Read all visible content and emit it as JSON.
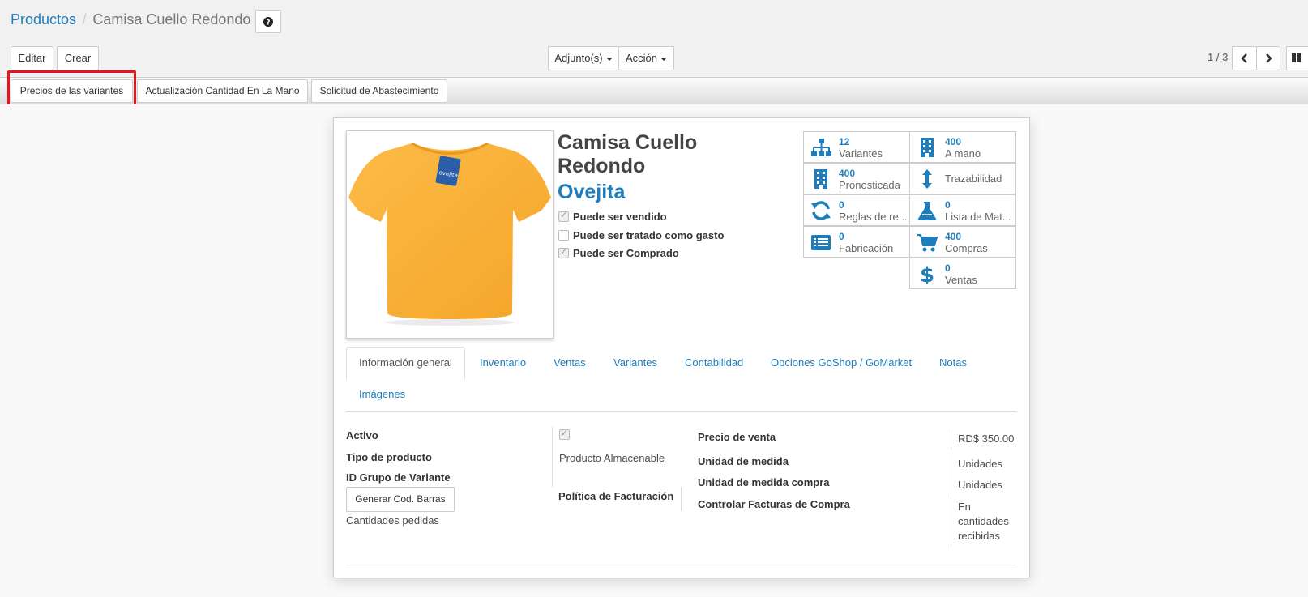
{
  "breadcrumb": {
    "parent": "Productos",
    "separator": "/",
    "current": "Camisa Cuello Redondo",
    "help_icon": "question-circle-icon"
  },
  "toolbar": {
    "edit_label": "Editar",
    "create_label": "Crear",
    "attachments_label": "Adjunto(s)",
    "action_label": "Acción",
    "pager": "1 / 3"
  },
  "statusbar": {
    "buttons": [
      "Precios de las variantes",
      "Actualización Cantidad En La Mano",
      "Solicitud de Abastecimiento"
    ]
  },
  "product": {
    "name_line1": "Camisa Cuello",
    "name_line2": "Redondo",
    "brand": "Ovejita",
    "image_icon": "orange-tshirt-image",
    "checkboxes": [
      {
        "label": "Puede ser vendido",
        "checked": true
      },
      {
        "label": "Puede ser tratado como gasto",
        "checked": false
      },
      {
        "label": "Puede ser Comprado",
        "checked": true
      }
    ]
  },
  "smart_buttons": [
    {
      "value": "12",
      "label": "Variantes",
      "icon": "sitemap-icon"
    },
    {
      "value": "400",
      "label": "A mano",
      "icon": "building-icon"
    },
    {
      "value": "400",
      "label": "Pronosticada",
      "icon": "building-icon"
    },
    {
      "value": "",
      "label": "Trazabilidad",
      "icon": "arrows-v-icon"
    },
    {
      "value": "0",
      "label": "Reglas de re...",
      "icon": "refresh-icon"
    },
    {
      "value": "0",
      "label": "Lista de Mat...",
      "icon": "flask-icon"
    },
    {
      "value": "0",
      "label": "Fabricación",
      "icon": "list-alt-icon"
    },
    {
      "value": "400",
      "label": "Compras",
      "icon": "shopping-cart-icon"
    },
    {
      "value": "0",
      "label": "Ventas",
      "icon": "dollar-icon"
    }
  ],
  "tabs": [
    "Información general",
    "Inventario",
    "Ventas",
    "Variantes",
    "Contabilidad",
    "Opciones GoShop / GoMarket",
    "Notas",
    "Imágenes"
  ],
  "general": {
    "active_label": "Activo",
    "active_checked": true,
    "type_label": "Tipo de producto",
    "type_value": "Producto Almacenable",
    "variant_group_label": "ID Grupo de Variante",
    "barcode_button": "Generar Cod. Barras",
    "ordered_qty_label": "Cantidades pedidas",
    "invoice_policy_label": "Política de Facturación",
    "sale_price_label": "Precio de venta",
    "sale_price_value": "RD$ 350.00",
    "uom_label": "Unidad de medida",
    "uom_value": "Unidades",
    "uom_po_label": "Unidad de medida compra",
    "uom_po_value": "Unidades",
    "purchase_control_label": "Controlar Facturas de Compra",
    "purchase_control_value_1": "En",
    "purchase_control_value_2": "cantidades",
    "purchase_control_value_3": "recibidas"
  },
  "colors": {
    "link": "#1f7dbb",
    "highlight": "#e8141b",
    "shirt": "#fbb13c"
  }
}
